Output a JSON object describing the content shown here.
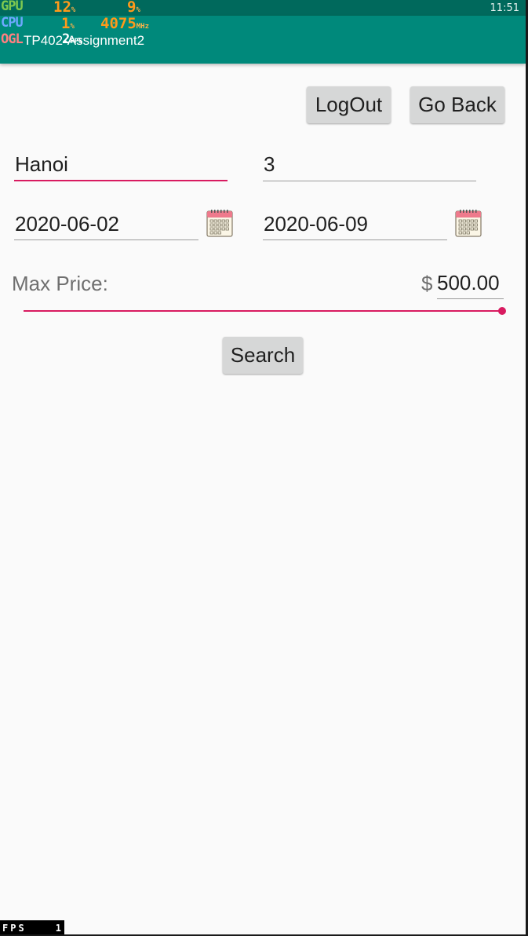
{
  "status_bar": {
    "time": "11:51"
  },
  "app_bar": {
    "title": "PRJ- TP402-Assignment2",
    "title_visible": "TP402-Assignment2"
  },
  "overlay": {
    "gpu_label": "GPU",
    "gpu_value": "12",
    "gpu_unit": "%",
    "gpu_value2": "9",
    "gpu_unit2": "%",
    "cpu_label": "CPU",
    "cpu_value": "1",
    "cpu_unit": "%",
    "cpu_freq": "4075",
    "cpu_freq_unit": "MHz",
    "ogl_label": "OGL",
    "fps_value": "2",
    "fps_unit": "FPS",
    "fps_box_label": "FPS",
    "fps_box_value": "1"
  },
  "toolbar": {
    "logout_label": "LogOut",
    "goback_label": "Go Back"
  },
  "form": {
    "city": {
      "value": "Hanoi"
    },
    "guests": {
      "value": "3"
    },
    "check_in": {
      "value": "2020-06-02",
      "icon": "calendar-icon"
    },
    "check_out": {
      "value": "2020-06-09",
      "icon": "calendar-icon"
    },
    "max_price": {
      "label": "Max Price:",
      "currency": "$",
      "value": "500.00",
      "slider_fraction": 1.0
    },
    "search_label": "Search"
  },
  "colors": {
    "accent": "#d81b60",
    "app_bar": "#00897b",
    "status_bar": "#00695c",
    "button": "#d6d7d7"
  }
}
